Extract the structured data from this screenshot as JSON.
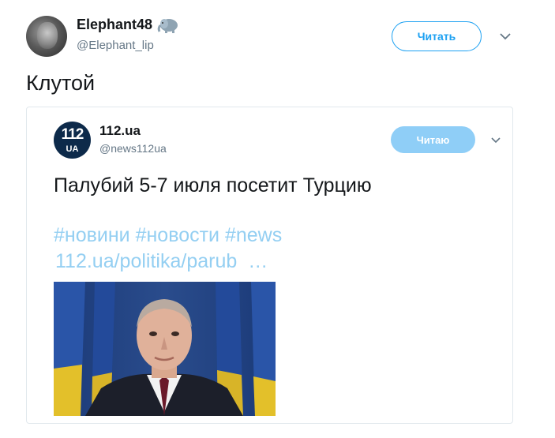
{
  "tweet": {
    "display_name": "Elephant48",
    "handle": "@Elephant_lip",
    "follow_label": "Читать",
    "text": "Клутой",
    "emoji_icon": "elephant-icon"
  },
  "quoted": {
    "logo_number": "112",
    "logo_sub": "UA",
    "display_name": "112.ua",
    "handle": "@news112ua",
    "follow_label": "Читаю",
    "text": "Палубий 5-7 июля посетит Турцию",
    "hashtags": "#новини #новости #news",
    "link": "112.ua/politika/parub",
    "link_ellipsis": "…"
  },
  "colors": {
    "accent": "#1da1f2",
    "follow_following": "#8fcef7",
    "link_faded": "#94cff2",
    "logo_bg": "#0d2a4a"
  }
}
